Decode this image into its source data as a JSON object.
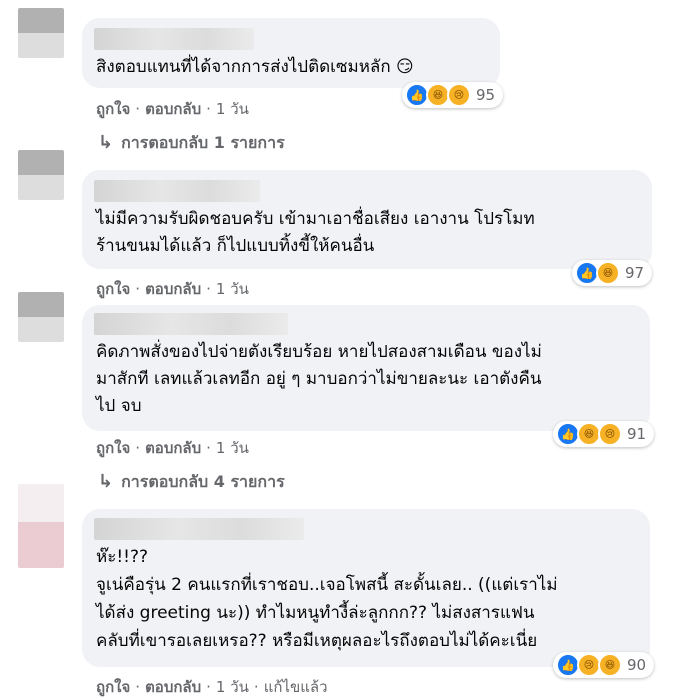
{
  "comments": [
    {
      "text": "สิงตอบแทนที่ได้จากการส่งไปติดเซมหลัก 😏",
      "like_label": "ถูกใจ",
      "reply_label": "ตอบกลับ",
      "time": "1 วัน",
      "reactions": [
        "like-icon",
        "haha-icon",
        "sad-icon"
      ],
      "reaction_count": "95",
      "replies_text": "การตอบกลับ 1 รายการ"
    },
    {
      "text": "ไม่มีความรับผิดชอบครับ เข้ามาเอาชื่อเสียง เอางาน โปรโมท\nร้านขนมได้แล้ว ก็ไปแบบทิ้งขี้ให้คนอื่น",
      "like_label": "ถูกใจ",
      "reply_label": "ตอบกลับ",
      "time": "1 วัน",
      "reactions": [
        "like-icon",
        "haha-icon"
      ],
      "reaction_count": "97"
    },
    {
      "text": "คิดภาพสั่งของไปจ่ายตังเรียบร้อย หายไปสองสามเดือน ของไม่\nมาสักที เลทแล้วเลทอีก อยู่ ๆ มาบอกว่าไม่ขายละนะ เอาตังคืน\nไป จบ",
      "like_label": "ถูกใจ",
      "reply_label": "ตอบกลับ",
      "time": "1 วัน",
      "reactions": [
        "like-icon",
        "haha-icon",
        "sad-icon"
      ],
      "reaction_count": "91",
      "replies_text": "การตอบกลับ 4 รายการ"
    },
    {
      "text": "ห๊ะ!!??\nจูเน่คือรุ่น 2 คนแรกที่เราชอบ..เจอโพสนี้ สะดั้นเลย.. ((แต่เราไม่\nได้ส่ง greeting นะ)) ทำไมหนูทำงี้ล่ะลูกกก?? ไม่สงสารแฟน\nคลับที่เขารอเลยเหรอ?? หรือมีเหตุผลอะไรถึงตอบไม่ได้คะเนี่ย",
      "like_label": "ถูกใจ",
      "reply_label": "ตอบกลับ",
      "time": "1 วัน",
      "edited": "แก้ไขแล้ว",
      "reactions": [
        "like-icon",
        "sad-icon",
        "haha-icon"
      ],
      "reaction_count": "90"
    }
  ],
  "colors": {
    "bubble": "#f0f2f5",
    "meta_text": "#65676b",
    "like_blue": "#1877f2",
    "emoji_yellow": "#f7b125"
  }
}
